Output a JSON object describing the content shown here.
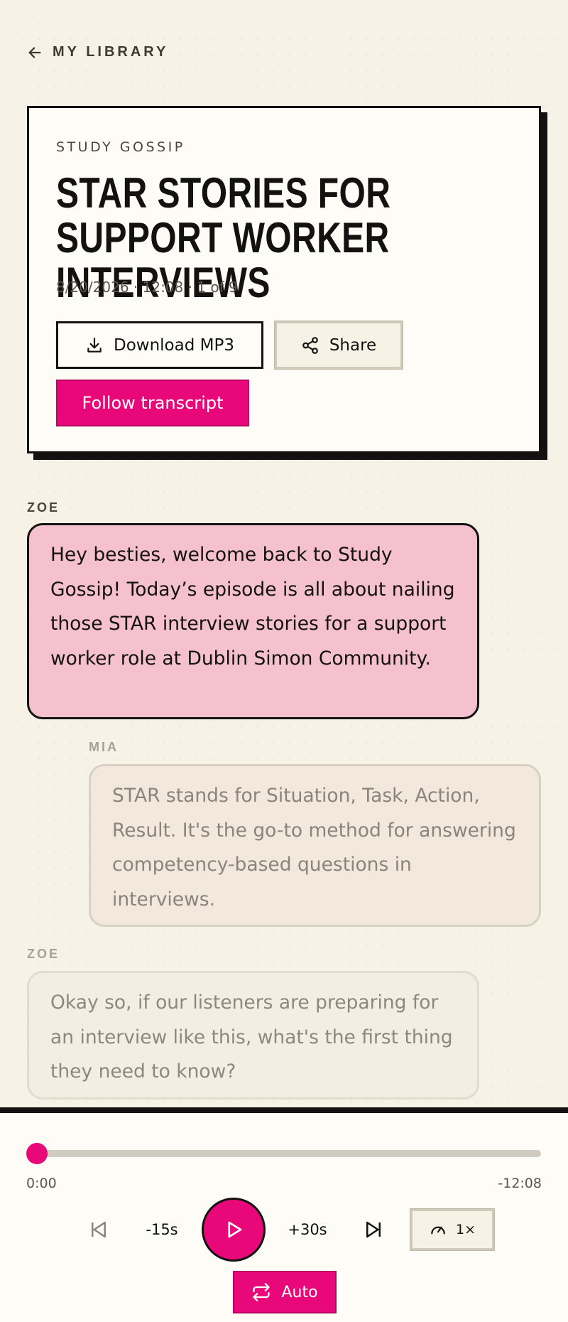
{
  "nav": {
    "back_label": "MY LIBRARY"
  },
  "episode": {
    "show_name": "STUDY GOSSIP",
    "title": "STAR STORIES FOR SUPPORT WORKER INTERVIEWS",
    "meta": "8/20/2026 · 12:08 · 1 of 9"
  },
  "actions": {
    "download_label": "Download MP3",
    "share_label": "Share",
    "follow_label": "Follow transcript"
  },
  "transcript": [
    {
      "speaker": "ZOE",
      "text": "Hey besties, welcome back to Study Gossip! Today’s episode is all about nailing those STAR interview stories for a support worker role at Dublin Simon Community."
    },
    {
      "speaker": "MIA",
      "text": "STAR stands for Situation, Task, Action, Result. It's the go-to method for answering competency-based questions in interviews."
    },
    {
      "speaker": "ZOE",
      "text": "Okay so, if our listeners are preparing for an interview like this, what's the first thing they need to know?"
    }
  ],
  "player": {
    "progress": 0,
    "elapsed": "0:00",
    "remaining": "-12:08",
    "rewind_label": "-15s",
    "forward_label": "+30s",
    "speed_label": "1×",
    "auto_label": "Auto"
  },
  "colors": {
    "accent": "#e8087a",
    "background": "#f6f2e6",
    "ink": "#141210",
    "active_bubble": "#f6c1cf"
  },
  "icons": [
    "arrow-left-icon",
    "download-icon",
    "share-icon",
    "skip-back-icon",
    "play-icon",
    "skip-forward-icon",
    "gauge-icon",
    "repeat-icon"
  ]
}
